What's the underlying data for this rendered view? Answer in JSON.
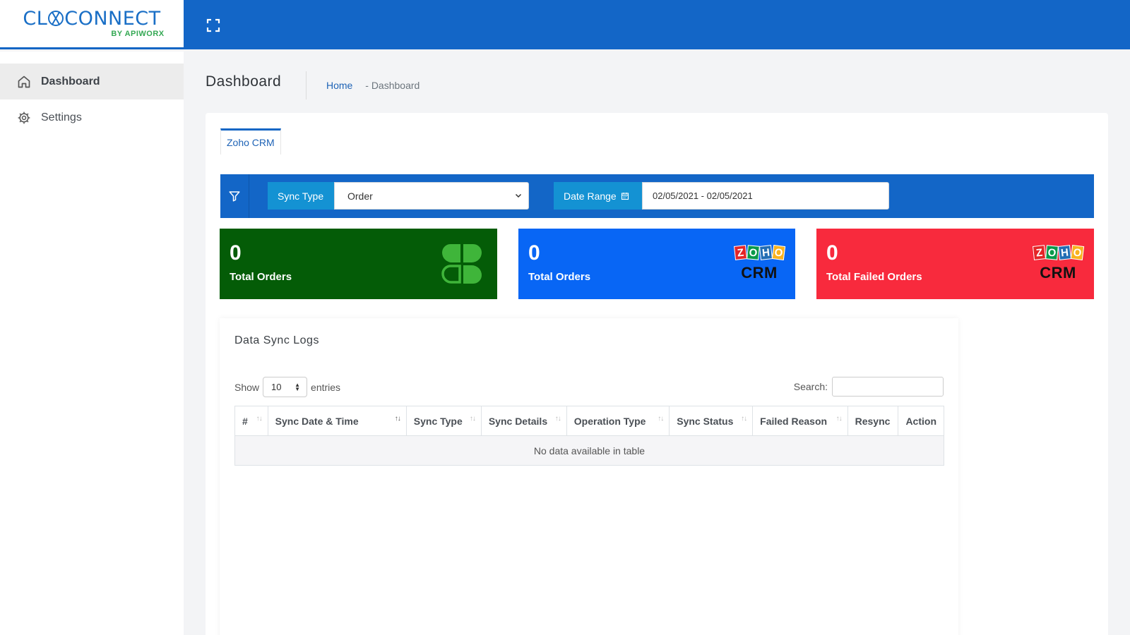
{
  "brand": {
    "name_part1": "CL",
    "name_part2": "CONNECT",
    "sub": "BY APIWORX"
  },
  "sidebar": {
    "items": [
      {
        "label": "Dashboard",
        "icon": "home-icon",
        "active": true
      },
      {
        "label": "Settings",
        "icon": "gear-icon",
        "active": false
      }
    ]
  },
  "header": {
    "title": "Dashboard",
    "breadcrumb": {
      "home": "Home",
      "separator": "-",
      "current": "Dashboard"
    }
  },
  "tabs": [
    {
      "label": "Zoho CRM",
      "active": true
    }
  ],
  "filters": {
    "sync_type_label": "Sync Type",
    "sync_type_value": "Order",
    "date_range_label": "Date Range",
    "date_range_value": "02/05/2021 - 02/05/2021"
  },
  "stats": [
    {
      "value": "0",
      "label": "Total Orders",
      "color": "#045c07",
      "logo": "clover-icon"
    },
    {
      "value": "0",
      "label": "Total Orders",
      "color": "#0866f5",
      "logo": "zoho-crm-logo"
    },
    {
      "value": "0",
      "label": "Total Failed Orders",
      "color": "#f82a3d",
      "logo": "zoho-crm-logo"
    }
  ],
  "zoho_logo": {
    "letters": [
      "Z",
      "O",
      "H",
      "O"
    ],
    "crm": "CRM"
  },
  "logs": {
    "title": "Data Sync Logs",
    "show_label": "Show",
    "entries_value": "10",
    "entries_label": "entries",
    "search_label": "Search:",
    "search_value": "",
    "columns": [
      "#",
      "Sync Date & Time",
      "Sync Type",
      "Sync Details",
      "Operation Type",
      "Sync Status",
      "Failed Reason",
      "Resync",
      "Action"
    ],
    "empty_message": "No data available in table"
  },
  "colors": {
    "primary": "#1366c7",
    "addon": "#1492d3",
    "green": "#045c07",
    "blue": "#0866f5",
    "red": "#f82a3d"
  }
}
